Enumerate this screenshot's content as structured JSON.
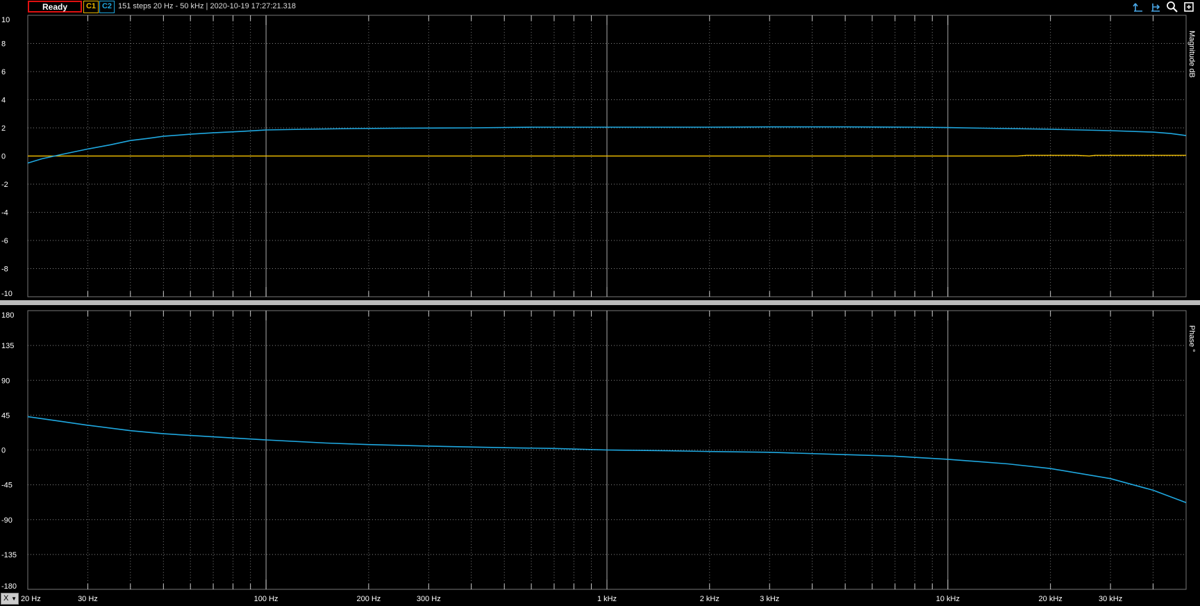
{
  "status": "Ready",
  "channels": [
    {
      "label": "C1",
      "color": "#e8b700"
    },
    {
      "label": "C2",
      "color": "#1fa8e0"
    }
  ],
  "info": "151 steps  20 Hz - 50 kHz | 2020-10-19 17:27:21.318",
  "toolbar_icons": [
    "cursor-a-icon",
    "cursor-b-icon",
    "zoom-icon",
    "fit-icon"
  ],
  "x_button": "X",
  "chart_data": [
    {
      "type": "line",
      "ylabel": "Magnitude dB",
      "xscale": "log",
      "xlim": [
        20,
        50000
      ],
      "ylim": [
        -10,
        10
      ],
      "yticks": [
        10,
        8,
        6,
        4,
        2,
        0,
        -2,
        -4,
        -6,
        -8,
        -10
      ],
      "grid": true,
      "series": [
        {
          "channel": "C1",
          "color": "#e8b700",
          "points": [
            [
              20,
              0.0
            ],
            [
              1000,
              0.0
            ],
            [
              16000,
              0.0
            ],
            [
              17000,
              0.05
            ],
            [
              24000,
              0.05
            ],
            [
              26000,
              0.0
            ],
            [
              27000,
              0.05
            ],
            [
              50000,
              0.05
            ]
          ]
        },
        {
          "channel": "C2",
          "color": "#1fa8e0",
          "points": [
            [
              20,
              -0.5
            ],
            [
              22,
              -0.2
            ],
            [
              25,
              0.1
            ],
            [
              30,
              0.5
            ],
            [
              35,
              0.8
            ],
            [
              40,
              1.1
            ],
            [
              45,
              1.25
            ],
            [
              50,
              1.4
            ],
            [
              60,
              1.55
            ],
            [
              70,
              1.65
            ],
            [
              85,
              1.75
            ],
            [
              100,
              1.85
            ],
            [
              130,
              1.9
            ],
            [
              180,
              1.95
            ],
            [
              250,
              1.98
            ],
            [
              400,
              2.0
            ],
            [
              600,
              2.05
            ],
            [
              1000,
              2.05
            ],
            [
              2000,
              2.05
            ],
            [
              3000,
              2.07
            ],
            [
              5000,
              2.07
            ],
            [
              8000,
              2.05
            ],
            [
              10000,
              2.02
            ],
            [
              15000,
              1.95
            ],
            [
              20000,
              1.9
            ],
            [
              30000,
              1.8
            ],
            [
              40000,
              1.7
            ],
            [
              45000,
              1.6
            ],
            [
              50000,
              1.45
            ]
          ]
        }
      ]
    },
    {
      "type": "line",
      "ylabel": "Phase °",
      "xscale": "log",
      "xlim": [
        20,
        50000
      ],
      "ylim": [
        -180,
        180
      ],
      "yticks": [
        180,
        135,
        90,
        45,
        0,
        -45,
        -90,
        -135,
        -180
      ],
      "grid": true,
      "series": [
        {
          "channel": "C2",
          "color": "#1fa8e0",
          "points": [
            [
              20,
              43
            ],
            [
              25,
              37
            ],
            [
              30,
              32
            ],
            [
              40,
              25
            ],
            [
              50,
              21
            ],
            [
              70,
              17
            ],
            [
              100,
              13
            ],
            [
              150,
              9
            ],
            [
              200,
              7
            ],
            [
              300,
              5
            ],
            [
              500,
              3
            ],
            [
              700,
              2
            ],
            [
              1000,
              0
            ],
            [
              1500,
              -1
            ],
            [
              2000,
              -2
            ],
            [
              3000,
              -3
            ],
            [
              5000,
              -6
            ],
            [
              7000,
              -8
            ],
            [
              10000,
              -12
            ],
            [
              15000,
              -18
            ],
            [
              20000,
              -24
            ],
            [
              30000,
              -37
            ],
            [
              40000,
              -52
            ],
            [
              50000,
              -68
            ]
          ]
        }
      ]
    }
  ],
  "x_axis": {
    "ticks": [
      {
        "v": 20,
        "label": "20 Hz"
      },
      {
        "v": 30,
        "label": "30 Hz"
      },
      {
        "v": 100,
        "label": "100 Hz"
      },
      {
        "v": 200,
        "label": "200 Hz"
      },
      {
        "v": 300,
        "label": "300 Hz"
      },
      {
        "v": 1000,
        "label": "1 kHz"
      },
      {
        "v": 2000,
        "label": "2 kHz"
      },
      {
        "v": 3000,
        "label": "3 kHz"
      },
      {
        "v": 10000,
        "label": "10 kHz"
      },
      {
        "v": 20000,
        "label": "20 kHz"
      },
      {
        "v": 30000,
        "label": "30 kHz"
      }
    ]
  }
}
